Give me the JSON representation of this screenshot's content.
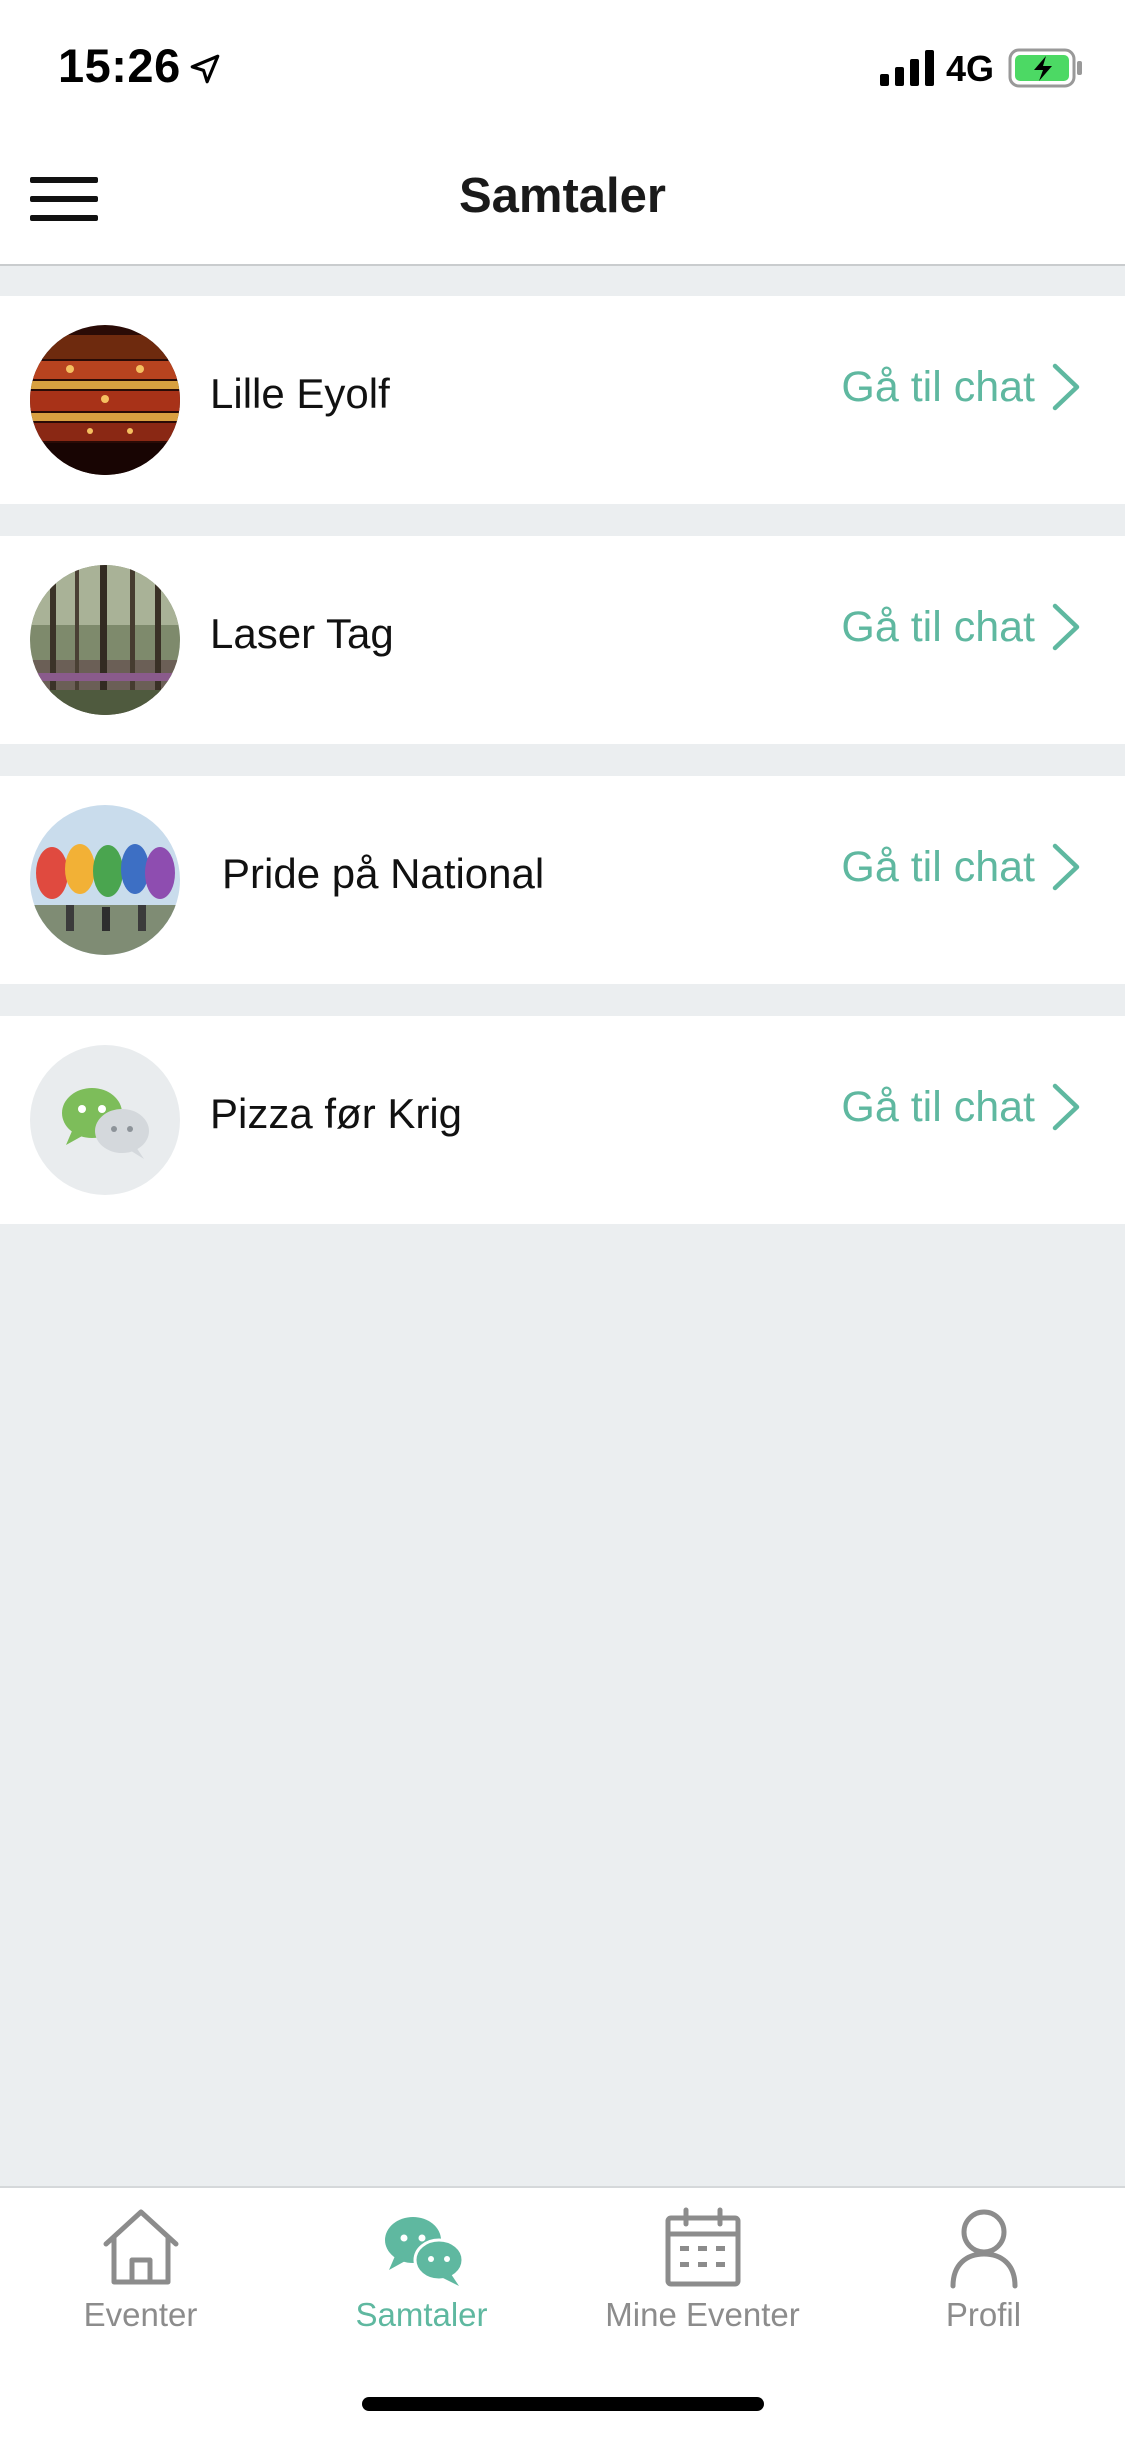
{
  "status_bar": {
    "time": "15:26",
    "network": "4G",
    "icons": [
      "location-arrow-icon",
      "signal-icon",
      "battery-charging-icon"
    ]
  },
  "header": {
    "title": "Samtaler",
    "menu_icon": "hamburger-menu-icon"
  },
  "chats": [
    {
      "name": "Lille Eyolf",
      "action": "Gå til chat",
      "avatar": "theater-photo"
    },
    {
      "name": "Laser Tag",
      "action": "Gå til chat",
      "avatar": "forest-photo"
    },
    {
      "name": "Pride på National",
      "action": "Gå til chat",
      "avatar": "pride-balloons-photo"
    },
    {
      "name": "Pizza før Krig",
      "action": "Gå til chat",
      "avatar": "chat-bubbles-icon"
    }
  ],
  "tab_bar": {
    "tabs": [
      {
        "label": "Eventer",
        "icon": "home-icon",
        "active": false
      },
      {
        "label": "Samtaler",
        "icon": "chat-bubbles-icon",
        "active": true
      },
      {
        "label": "Mine Eventer",
        "icon": "calendar-icon",
        "active": false
      },
      {
        "label": "Profil",
        "icon": "person-icon",
        "active": false
      }
    ]
  },
  "colors": {
    "accent": "#5fb8a0",
    "background": "#ebeef0",
    "inactive_tab": "#8c8c8c"
  }
}
